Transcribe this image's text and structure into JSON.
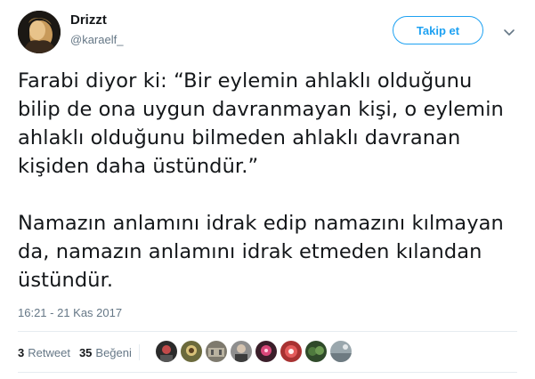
{
  "author": {
    "name": "Drizzt",
    "handle": "@karaelf_",
    "avatar_icon": "profile-avatar"
  },
  "follow_button_label": "Takip et",
  "more_icon": "chevron-down-icon",
  "tweet": {
    "paragraphs": [
      "Farabi diyor ki: “Bir eylemin ahlaklı olduğunu bilip de ona uygun davranmayan kişi, o eylemin ahlaklı olduğunu bilmeden ahlaklı davranan kişiden daha üstündür.”",
      "Namazın anlamını idrak edip namazını kılmayan da, namazın anlamını idrak etmeden kılandan üstündür."
    ]
  },
  "timestamp": "16:21 - 21 Kas 2017",
  "stats": {
    "retweet_count": "3",
    "retweet_label": "Retweet",
    "like_count": "35",
    "like_label": "Beğeni"
  },
  "likers": [
    "liker-avatar-1",
    "liker-avatar-2",
    "liker-avatar-3",
    "liker-avatar-4",
    "liker-avatar-5",
    "liker-avatar-6",
    "liker-avatar-7",
    "liker-avatar-8"
  ],
  "colors": {
    "accent": "#1da1f2",
    "text": "#14171a",
    "secondary": "#657786",
    "divider": "#e6ecf0"
  }
}
